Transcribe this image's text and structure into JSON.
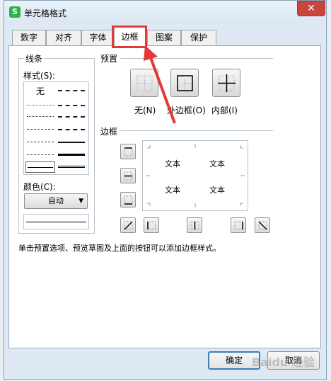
{
  "window": {
    "title": "单元格格式",
    "app_icon_glyph": "S",
    "close_glyph": "✕"
  },
  "tabs": [
    {
      "label": "数字"
    },
    {
      "label": "对齐"
    },
    {
      "label": "字体"
    },
    {
      "label": "边框",
      "active": true
    },
    {
      "label": "图案"
    },
    {
      "label": "保护"
    }
  ],
  "line_group": {
    "title": "线条",
    "style_label": "样式(S):",
    "none_label": "无",
    "color_label": "颜色(C):",
    "color_value": "自动"
  },
  "presets_group": {
    "title": "预置",
    "presets": [
      {
        "label": "无(N)",
        "icon": "no-border-icon"
      },
      {
        "label": "外边框(O)",
        "icon": "outline-border-icon"
      },
      {
        "label": "内部(I)",
        "icon": "inside-border-icon"
      }
    ]
  },
  "border_group": {
    "title": "边框",
    "preview_texts": [
      "文本",
      "文本",
      "文本",
      "文本"
    ]
  },
  "hint": "单击预置选项、预览草图及上面的按钮可以添加边框样式。",
  "buttons": {
    "ok": "确定",
    "cancel": "取消"
  },
  "watermark": "Baidu 经验",
  "colors": {
    "highlight": "#e23a36",
    "window_bg": "#dfe9f3",
    "close": "#c9463d",
    "default_btn_border": "#3c7fb1"
  }
}
